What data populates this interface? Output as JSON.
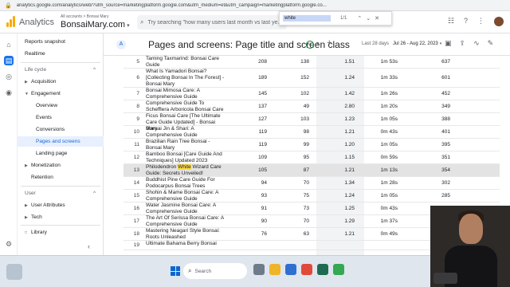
{
  "browser": {
    "url": "analytics.google.com/analytics/web/?utm_source=marketingplatform.google.com&utm_medium=et&utm_campaign=marketingplatform.google.co..."
  },
  "find_bar": {
    "query": "white",
    "count": "1/1"
  },
  "header": {
    "app_name": "Analytics",
    "account_line": "All accounts > Bonsai Mary",
    "account_name": "BonsaiMary.com",
    "search_placeholder": "Try searching \"how many users last month vs last ye..."
  },
  "sidebar": {
    "reports_snapshot": "Reports snapshot",
    "realtime": "Realtime",
    "life_cycle": "Life cycle",
    "acquisition": "Acquisition",
    "engagement": "Engagement",
    "overview": "Overview",
    "events": "Events",
    "conversions": "Conversions",
    "pages_and_screens": "Pages and screens",
    "landing_page": "Landing page",
    "monetization": "Monetization",
    "retention": "Retention",
    "user": "User",
    "user_attributes": "User Attributes",
    "tech": "Tech",
    "library": "Library"
  },
  "page": {
    "avatar_letter": "A",
    "title": "Pages and screens: Page title and screen class",
    "date_label": "Last 28 days",
    "date_range": "Jul 26 - Aug 22, 2023"
  },
  "table": {
    "rows": [
      {
        "n": "5",
        "title": "Taming Taxmarind: Bonsai Care Guide",
        "c1": "208",
        "c2": "138",
        "c3": "1.51",
        "c4": "1m 53s",
        "c5": "637"
      },
      {
        "n": "6",
        "title": "What Is Yamadori Bonsai? [Collecting Bonsai In The Forest] - Bonsai Mary",
        "c1": "189",
        "c2": "152",
        "c3": "1.24",
        "c4": "1m 33s",
        "c5": "601"
      },
      {
        "n": "7",
        "title": "Bonsai Mimosa Care: A Comprehensive Guide",
        "c1": "145",
        "c2": "102",
        "c3": "1.42",
        "c4": "1m 26s",
        "c5": "452"
      },
      {
        "n": "8",
        "title": "Comprehensive Guide To Schefflera Arboricola Bonsai Care",
        "c1": "137",
        "c2": "49",
        "c3": "2.80",
        "c4": "1m 20s",
        "c5": "349"
      },
      {
        "n": "9",
        "title": "Ficus Bonsai Care [The Ultimate Care Guide Updated] - Bonsai Mary",
        "c1": "127",
        "c2": "103",
        "c3": "1.23",
        "c4": "1m 05s",
        "c5": "388"
      },
      {
        "n": "10",
        "title": "Bonsai Jin & Shari: A Comprehensive Guide",
        "c1": "119",
        "c2": "98",
        "c3": "1.21",
        "c4": "0m 43s",
        "c5": "401"
      },
      {
        "n": "11",
        "title": "Brazilian Rain Tree Bonsai - Bonsai Mary",
        "c1": "119",
        "c2": "99",
        "c3": "1.20",
        "c4": "1m 05s",
        "c5": "395"
      },
      {
        "n": "12",
        "title": "Bamboo Bonsai [Care Guide And Techniques] Updated 2023",
        "c1": "109",
        "c2": "95",
        "c3": "1.15",
        "c4": "0m 59s",
        "c5": "351"
      },
      {
        "n": "13",
        "title_pre": "Philodendron ",
        "title_match": "White",
        "title_post": " Wizard Care Guide: Secrets Unveiled!",
        "c1": "105",
        "c2": "87",
        "c3": "1.21",
        "c4": "1m 13s",
        "c5": "354"
      },
      {
        "n": "14",
        "title": "Buddhist Pine Care Guide For Podocarpus Bonsai Trees",
        "c1": "94",
        "c2": "70",
        "c3": "1.34",
        "c4": "1m 28s",
        "c5": "302"
      },
      {
        "n": "15",
        "title": "Shohin & Mame Bonsai Care: A Comprehensive Guide",
        "c1": "93",
        "c2": "75",
        "c3": "1.24",
        "c4": "1m 05s",
        "c5": "285"
      },
      {
        "n": "16",
        "title": "Water Jasmine Bonsai Care: A Comprehensive Guide",
        "c1": "91",
        "c2": "73",
        "c3": "1.25",
        "c4": "0m 43s",
        "c5": "267"
      },
      {
        "n": "17",
        "title": "The Art Of Serissa Bonsai Care: A Comprehensive Guide",
        "c1": "90",
        "c2": "70",
        "c3": "1.29",
        "c4": "1m 37s",
        "c5": "279"
      },
      {
        "n": "18",
        "title": "Mastering Neagari Style Bonsai: Roots Unleashed",
        "c1": "76",
        "c2": "63",
        "c3": "1.21",
        "c4": "0m 49s",
        "c5": "263"
      },
      {
        "n": "19",
        "title": "Ultimate Bahama Berry Bonsai",
        "c1": "",
        "c2": "",
        "c3": "",
        "c4": "",
        "c5": ""
      }
    ]
  },
  "taskbar": {
    "search_label": "Search"
  },
  "colors": {
    "accent": "#1a73e8",
    "logo": "#f9ab00",
    "highlight": "#f9d949"
  }
}
